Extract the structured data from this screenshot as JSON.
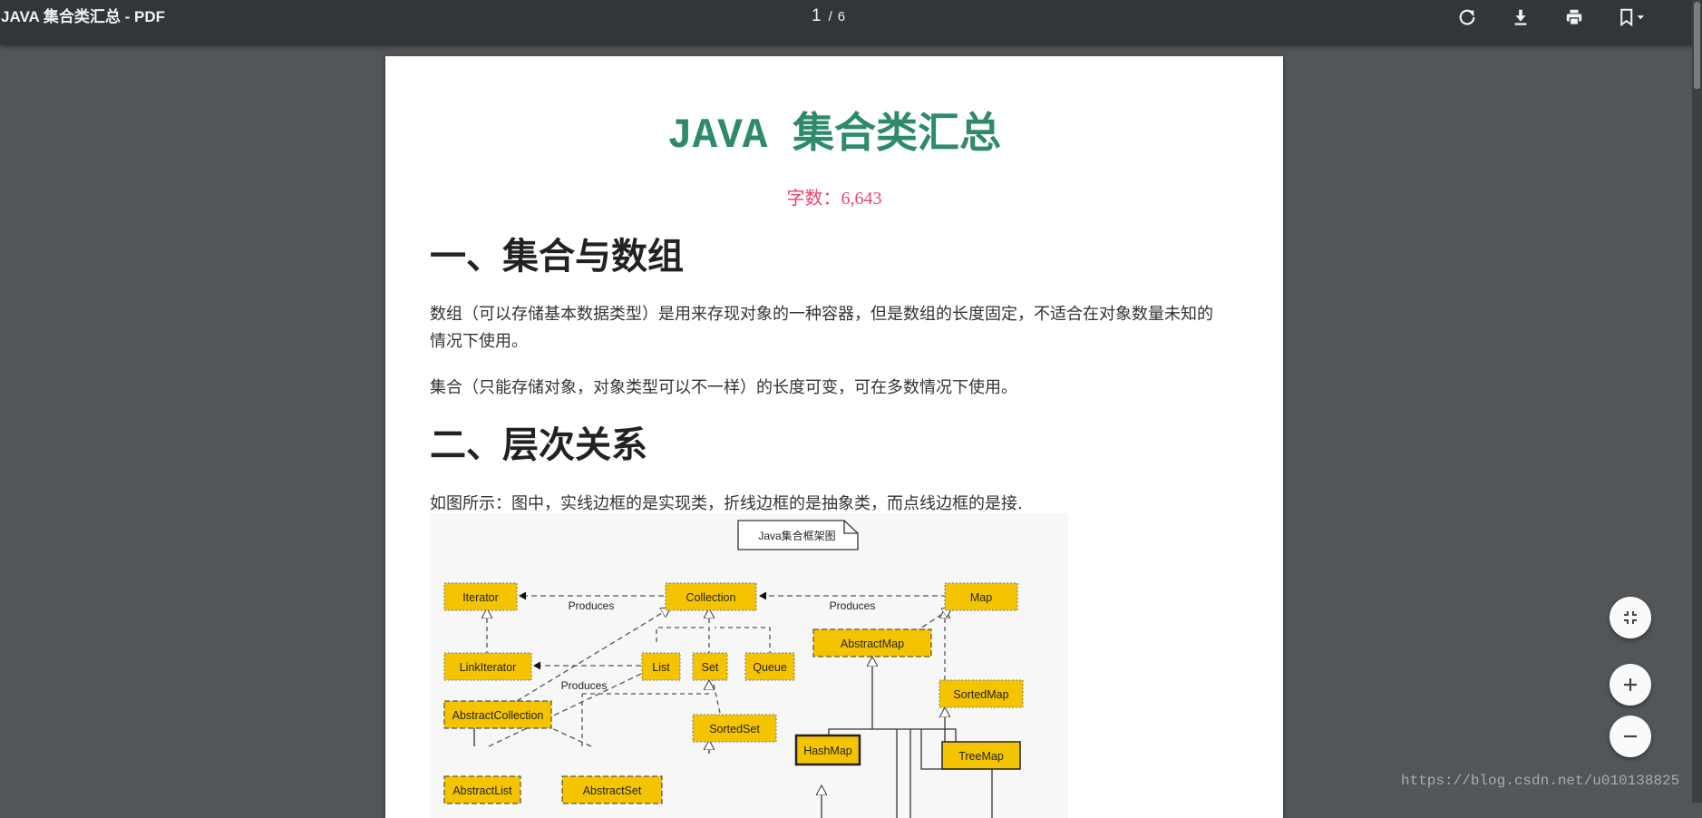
{
  "toolbar": {
    "title": "JAVA 集合类汇总 - PDF",
    "current_page": "1",
    "page_separator": "/",
    "total_pages": "6",
    "icons": [
      "rotate-icon",
      "download-icon",
      "print-icon",
      "bookmark-icon",
      "chevron-down-icon"
    ]
  },
  "document": {
    "title": "JAVA 集合类汇总",
    "word_count": "字数：6,643",
    "sections": [
      {
        "heading": "一、集合与数组",
        "paragraphs": [
          "数组（可以存储基本数据类型）是用来存现对象的一种容器，但是数组的长度固定，不适合在对象数量未知的情况下使用。",
          "集合（只能存储对象，对象类型可以不一样）的长度可变，可在多数情况下使用。"
        ]
      },
      {
        "heading": "二、层次关系",
        "paragraphs": [
          "如图所示：图中，实线边框的是实现类，折线边框的是抽象类，而点线边框的是接."
        ]
      }
    ],
    "diagram": {
      "note": "Java集合框架图",
      "nodes": {
        "iterator": "Iterator",
        "collection": "Collection",
        "map": "Map",
        "linkiterator": "LinkIterator",
        "list": "List",
        "set": "Set",
        "queue": "Queue",
        "abstractmap": "AbstractMap",
        "sortedmap": "SortedMap",
        "abstractcollection": "AbstractCollection",
        "sortedset": "SortedSet",
        "hashmap": "HashMap",
        "treemap": "TreeMap",
        "abstractlist": "AbstractList",
        "abstractset": "AbstractSet"
      },
      "edge_labels": {
        "produces_left": "Produces",
        "produces_right": "Produces",
        "produces_list": "Produces"
      }
    }
  },
  "controls": {
    "icons": [
      "fit-page-icon",
      "zoom-in-icon",
      "zoom-out-icon"
    ]
  },
  "watermark": "https://blog.csdn.net/u010138825",
  "colors": {
    "toolbar_bg": "#323639",
    "viewer_bg": "#525659",
    "title_green": "#2f8a6b",
    "wordcount_pink": "#e8466a",
    "node_yellow": "#f5c400"
  }
}
